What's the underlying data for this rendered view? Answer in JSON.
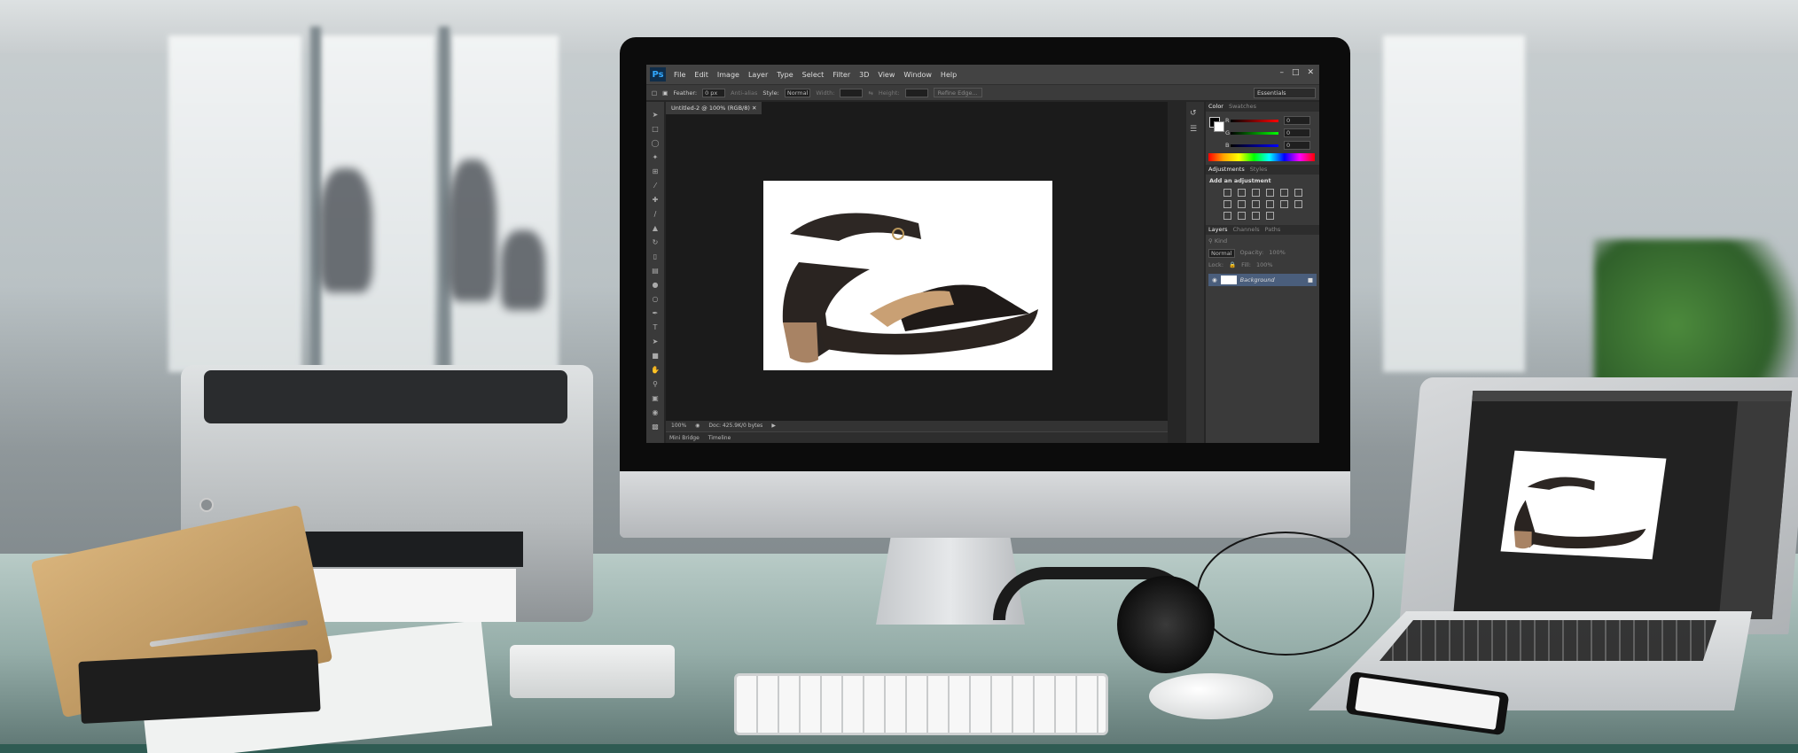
{
  "photoshop": {
    "logo": "Ps",
    "menu": [
      "File",
      "Edit",
      "Image",
      "Layer",
      "Type",
      "Select",
      "Filter",
      "3D",
      "View",
      "Window",
      "Help"
    ],
    "options": {
      "feather_label": "Feather:",
      "feather_value": "0 px",
      "anti_alias": "Anti-alias",
      "style_label": "Style:",
      "style_value": "Normal",
      "width_label": "Width:",
      "height_label": "Height:",
      "refine_edge": "Refine Edge...",
      "workspace": "Essentials"
    },
    "document_tab": "Untitled-2 @ 100% (RGB/8)",
    "status": {
      "zoom": "100%",
      "doc_info": "Doc: 425.9K/0 bytes"
    },
    "bottom_tabs": [
      "Mini Bridge",
      "Timeline"
    ],
    "panels": {
      "color_tabs": [
        "Color",
        "Swatches"
      ],
      "color_channels": [
        {
          "label": "R",
          "value": "0"
        },
        {
          "label": "G",
          "value": "0"
        },
        {
          "label": "B",
          "value": "0"
        }
      ],
      "adjustment_tabs": [
        "Adjustments",
        "Styles"
      ],
      "adjustment_heading": "Add an adjustment",
      "layers_tabs": [
        "Layers",
        "Channels",
        "Paths"
      ],
      "layer_filter": "Kind",
      "blend_mode": "Normal",
      "opacity_label": "Opacity:",
      "opacity_value": "100%",
      "lock_label": "Lock:",
      "fill_label": "Fill:",
      "fill_value": "100%",
      "layer_name": "Background"
    }
  },
  "colors": {
    "ps_bg": "#262626",
    "ps_accent": "#31a8ff",
    "layer_selected": "#4a5e7c"
  }
}
